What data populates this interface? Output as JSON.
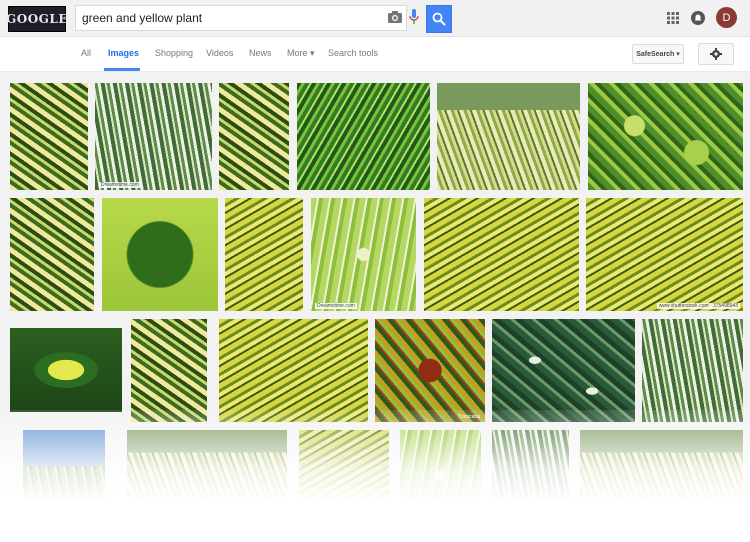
{
  "header": {
    "logo_text": "GOOGLE",
    "search_value": "green and yellow plant",
    "avatar_letter": "D",
    "accent_color": "#4285f4"
  },
  "tabs": [
    {
      "label": "All"
    },
    {
      "label": "Images"
    },
    {
      "label": "Shopping"
    },
    {
      "label": "Videos"
    },
    {
      "label": "News"
    },
    {
      "label": "More ▾"
    },
    {
      "label": "Search tools"
    }
  ],
  "safesearch_label": "SafeSearch ▾",
  "icons": [
    "camera-icon",
    "microphone-icon",
    "search-icon",
    "apps-grid-icon",
    "notifications-icon",
    "gear-icon"
  ],
  "watermarks": {
    "w1": "Dreamstime.com",
    "w2": "Dreamstime.com",
    "w3": "www.shutterstock.com · 375498943",
    "w4": "Tropicana"
  }
}
